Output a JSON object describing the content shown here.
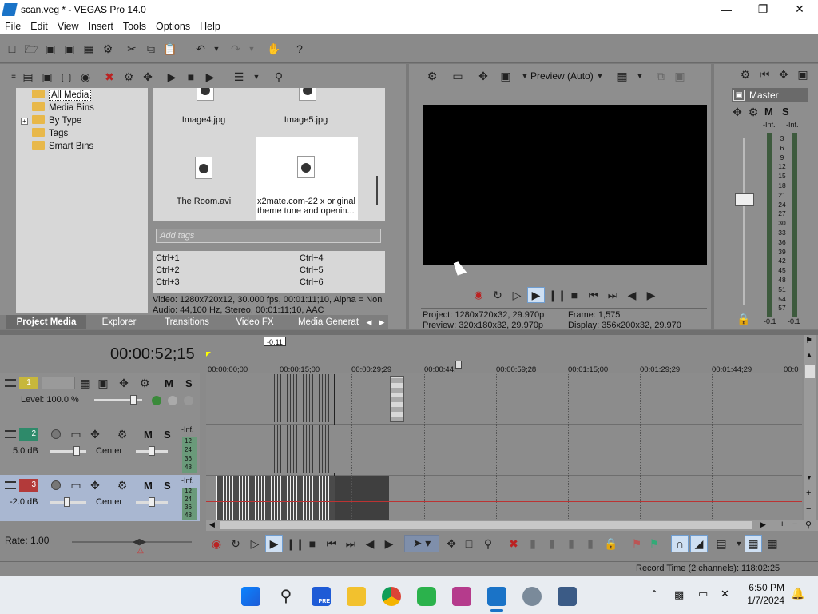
{
  "window": {
    "title": "scan.veg * - VEGAS Pro 14.0"
  },
  "menu": [
    "File",
    "Edit",
    "View",
    "Insert",
    "Tools",
    "Options",
    "Help"
  ],
  "project_media": {
    "tree": [
      "All Media",
      "Media Bins",
      "By Type",
      "Tags",
      "Smart Bins"
    ],
    "files": [
      {
        "name": "Image4.jpg",
        "type": "image"
      },
      {
        "name": "Image5.jpg",
        "type": "image"
      },
      {
        "name": "The Room.avi",
        "type": "video"
      },
      {
        "name": "x2mate.com-22 x original theme tune and openin...",
        "type": "video"
      }
    ],
    "tags_placeholder": "Add tags",
    "shortcuts": [
      "Ctrl+1",
      "Ctrl+2",
      "Ctrl+3",
      "Ctrl+4",
      "Ctrl+5",
      "Ctrl+6"
    ],
    "info_video": "Video: 1280x720x12, 30.000 fps, 00:01:11;10, Alpha = Non",
    "info_audio": "Audio: 44,100 Hz, Stereo, 00:01:11;10, AAC"
  },
  "tabs": [
    "Project Media",
    "Explorer",
    "Transitions",
    "Video FX",
    "Media Generat"
  ],
  "preview": {
    "mode": "Preview (Auto)",
    "project": "Project:  1280x720x32, 29.970p",
    "preview": "Preview:  320x180x32, 29.970p",
    "frame": "Frame:     1,575",
    "display": "Display:   356x200x32, 29.970"
  },
  "master": {
    "label": "Master",
    "inf_left": "-Inf.",
    "inf_right": "-Inf.",
    "scale": [
      "3",
      "6",
      "9",
      "12",
      "15",
      "18",
      "21",
      "24",
      "27",
      "30",
      "33",
      "36",
      "39",
      "42",
      "45",
      "48",
      "51",
      "54",
      "57"
    ],
    "bottom_left": "-0.1",
    "bottom_right": "-0.1"
  },
  "timeline": {
    "time": "00:00:52;15",
    "marker": "-0:11",
    "ticks": [
      "00:00:00;00",
      "00:00:15;00",
      "00:00:29;29",
      "00:00:44;",
      "00:00:59;28",
      "00:01:15;00",
      "00:01:29;29",
      "00:01:44;29",
      "00:0"
    ],
    "tracks": [
      {
        "num": "1",
        "kind": "video",
        "level_label": "Level: 100.0 %"
      },
      {
        "num": "2",
        "kind": "audio",
        "vol": "5.0 dB",
        "pan": "Center",
        "inf": "-Inf.",
        "meter": [
          "12",
          "24",
          "36",
          "48"
        ]
      },
      {
        "num": "3",
        "kind": "audio",
        "vol": "-2.0 dB",
        "pan": "Center",
        "inf": "-Inf.",
        "meter": [
          "12",
          "24",
          "36",
          "48"
        ]
      }
    ],
    "rate": "Rate: 1.00",
    "mute": "M",
    "solo": "S"
  },
  "status": {
    "record_time": "Record Time (2 channels): 118:02:25"
  },
  "taskbar": {
    "time": "6:50 PM",
    "date": "1/7/2024",
    "pre_badge": "PRE"
  },
  "colors": {
    "accent": "#1a73c7",
    "preview_bg": "#000000",
    "track_select": "#a9b7d1"
  }
}
